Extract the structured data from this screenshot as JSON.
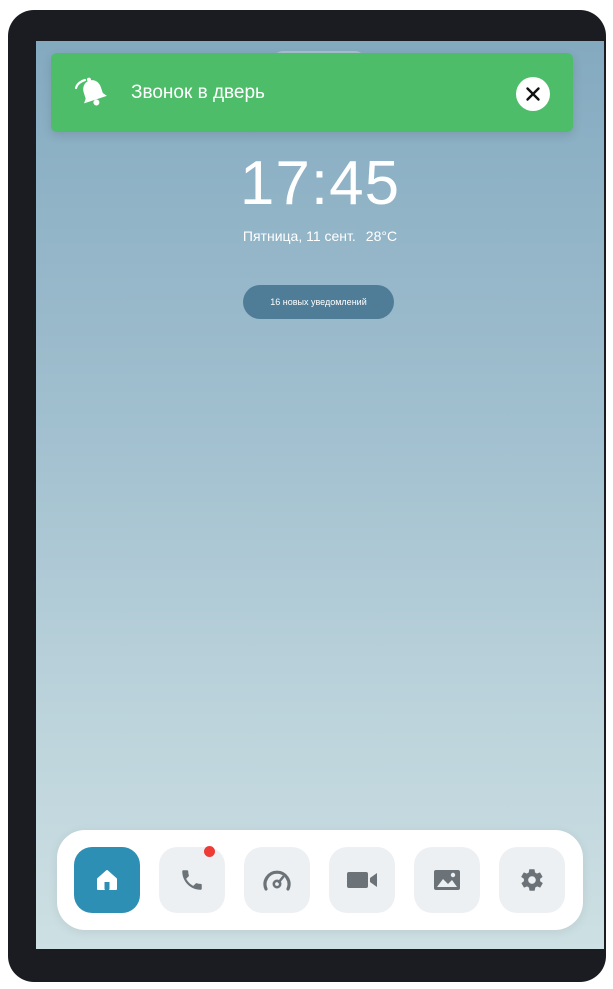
{
  "notification": {
    "text": "Звонок в дверь",
    "icon": "bell-icon",
    "close_icon": "close-icon",
    "color": "#4dbd6a"
  },
  "lockscreen": {
    "time": "17:45",
    "date": "Пятница, 11 сент.",
    "temperature": "28°C",
    "notifications_label": "16 новых уведомлений"
  },
  "dock": {
    "items": [
      {
        "name": "home",
        "icon": "home-icon",
        "active": true
      },
      {
        "name": "calls",
        "icon": "phone-icon",
        "badge": true
      },
      {
        "name": "dashboard",
        "icon": "gauge-icon"
      },
      {
        "name": "video",
        "icon": "video-camera-icon"
      },
      {
        "name": "gallery",
        "icon": "image-icon"
      },
      {
        "name": "settings",
        "icon": "gear-icon"
      }
    ],
    "accent_color": "#2e8fb5",
    "badge_color": "#ef3b36"
  }
}
